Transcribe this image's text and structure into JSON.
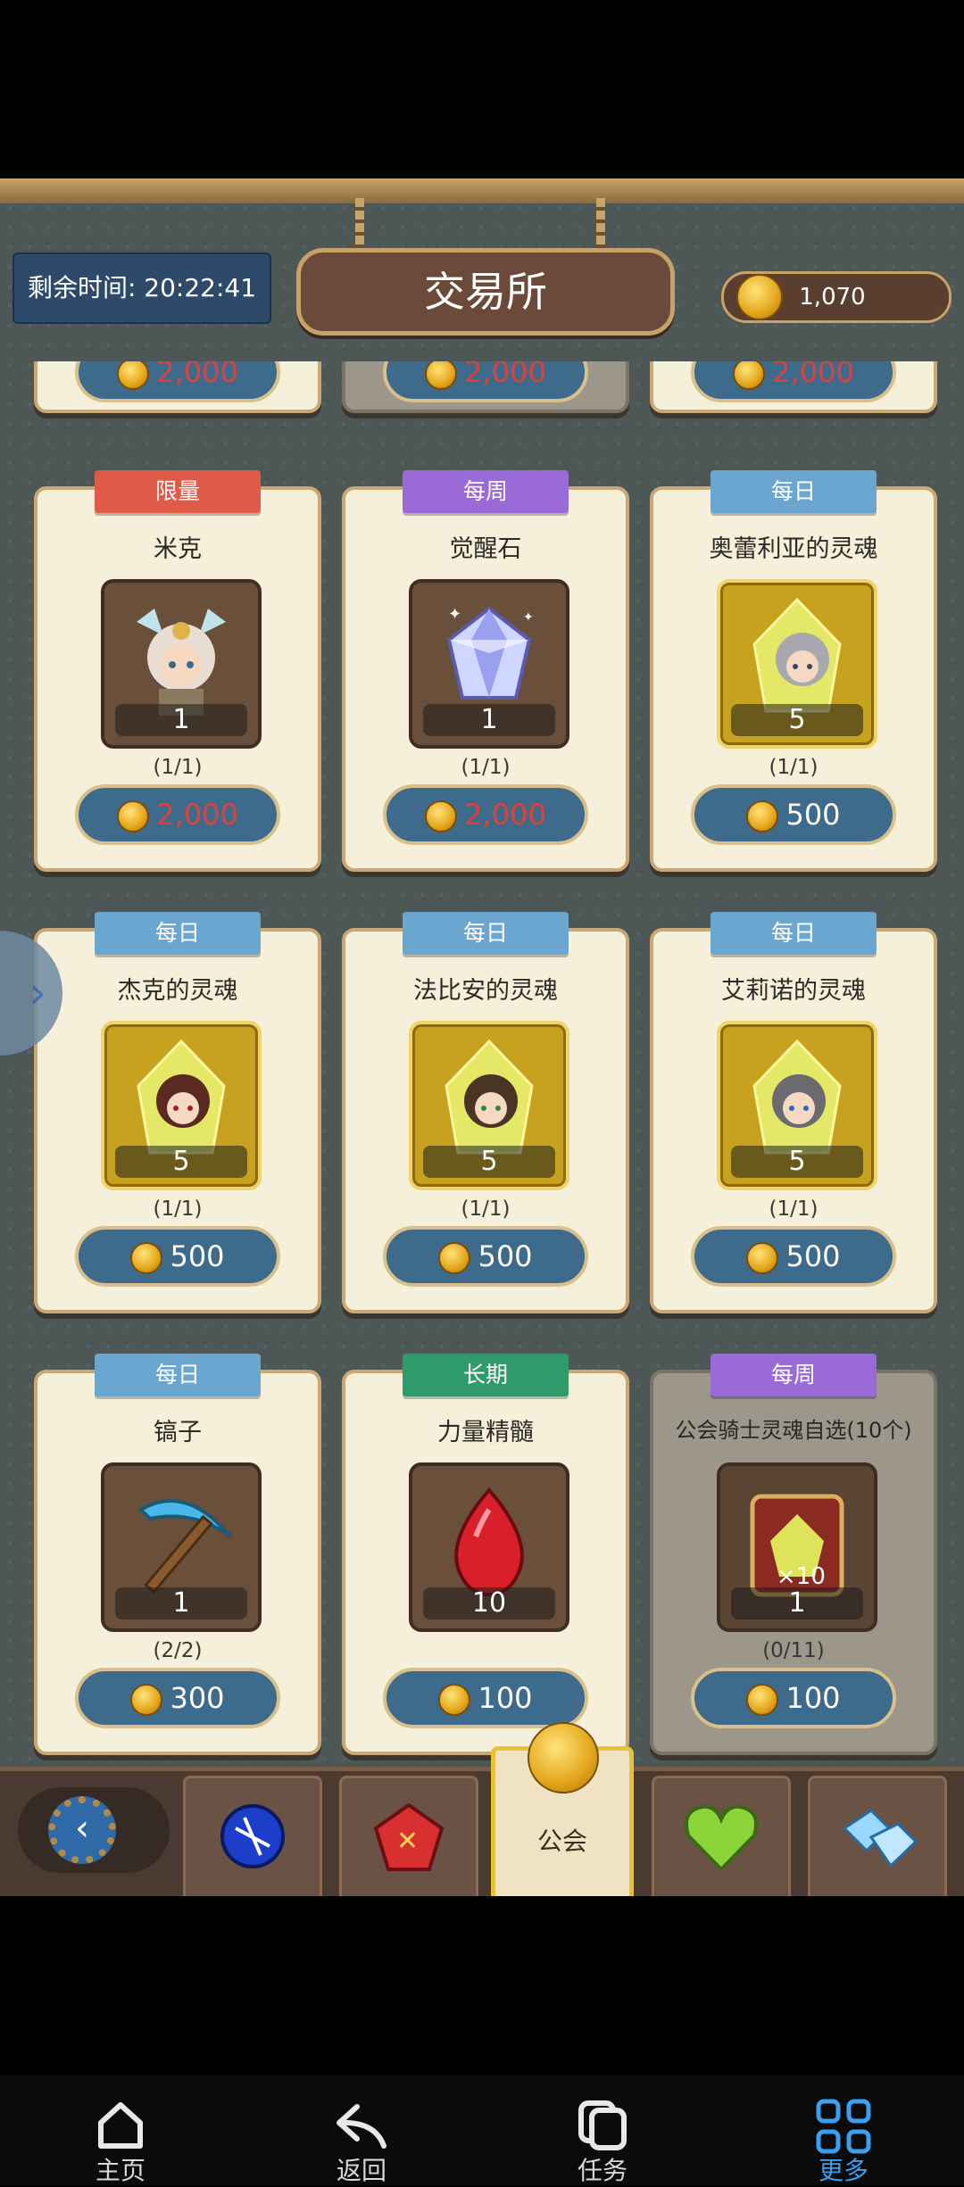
{
  "header": {
    "timer_text": "剩余时间: 20:22:41",
    "title": "交易所",
    "currency_amount": "1,070"
  },
  "top_partial_prices": [
    "2,000",
    "2,000",
    "2,000"
  ],
  "cards": [
    {
      "badge": "限量",
      "badge_color": "#e05a48",
      "title": "米克",
      "qty": "1",
      "limit": "(1/1)",
      "price": "2,000",
      "price_red": true,
      "icon": "character-portrait-icon"
    },
    {
      "badge": "每周",
      "badge_color": "#9a6ad6",
      "title": "觉醒石",
      "qty": "1",
      "limit": "(1/1)",
      "price": "2,000",
      "price_red": true,
      "icon": "crystal-gem-icon"
    },
    {
      "badge": "每日",
      "badge_color": "#6aa6cf",
      "title": "奥蕾利亚的灵魂",
      "qty": "5",
      "limit": "(1/1)",
      "price": "500",
      "price_red": false,
      "icon": "soul-crystal-icon"
    },
    {
      "badge": "每日",
      "badge_color": "#6aa6cf",
      "title": "杰克的灵魂",
      "qty": "5",
      "limit": "(1/1)",
      "price": "500",
      "price_red": false,
      "icon": "soul-crystal-icon"
    },
    {
      "badge": "每日",
      "badge_color": "#6aa6cf",
      "title": "法比安的灵魂",
      "qty": "5",
      "limit": "(1/1)",
      "price": "500",
      "price_red": false,
      "icon": "soul-crystal-icon"
    },
    {
      "badge": "每日",
      "badge_color": "#6aa6cf",
      "title": "艾莉诺的灵魂",
      "qty": "5",
      "limit": "(1/1)",
      "price": "500",
      "price_red": false,
      "icon": "soul-crystal-icon"
    },
    {
      "badge": "每日",
      "badge_color": "#6aa6cf",
      "title": "镐子",
      "qty": "1",
      "limit": "(2/2)",
      "price": "300",
      "price_red": false,
      "icon": "pickaxe-icon"
    },
    {
      "badge": "长期",
      "badge_color": "#2f9a6a",
      "title": "力量精髓",
      "qty": "10",
      "limit": "",
      "price": "100",
      "price_red": false,
      "icon": "red-gem-icon"
    },
    {
      "badge": "每周",
      "badge_color": "#9a6ad6",
      "title": "公会骑士灵魂自选(10个)",
      "qty": "1",
      "limit": "(0/11)",
      "price": "100",
      "price_red": false,
      "icon": "soul-chest-icon"
    }
  ],
  "shop_tabs": {
    "active_label": "公会"
  },
  "android_nav": [
    {
      "label": "主页",
      "icon": "home-icon"
    },
    {
      "label": "返回",
      "icon": "back-icon"
    },
    {
      "label": "任务",
      "icon": "tasks-icon"
    },
    {
      "label": "更多",
      "icon": "more-icon"
    }
  ],
  "colors": {
    "accent_nav": "#3a9ff0",
    "price_red": "#e0403a",
    "background": "#4d5755"
  }
}
